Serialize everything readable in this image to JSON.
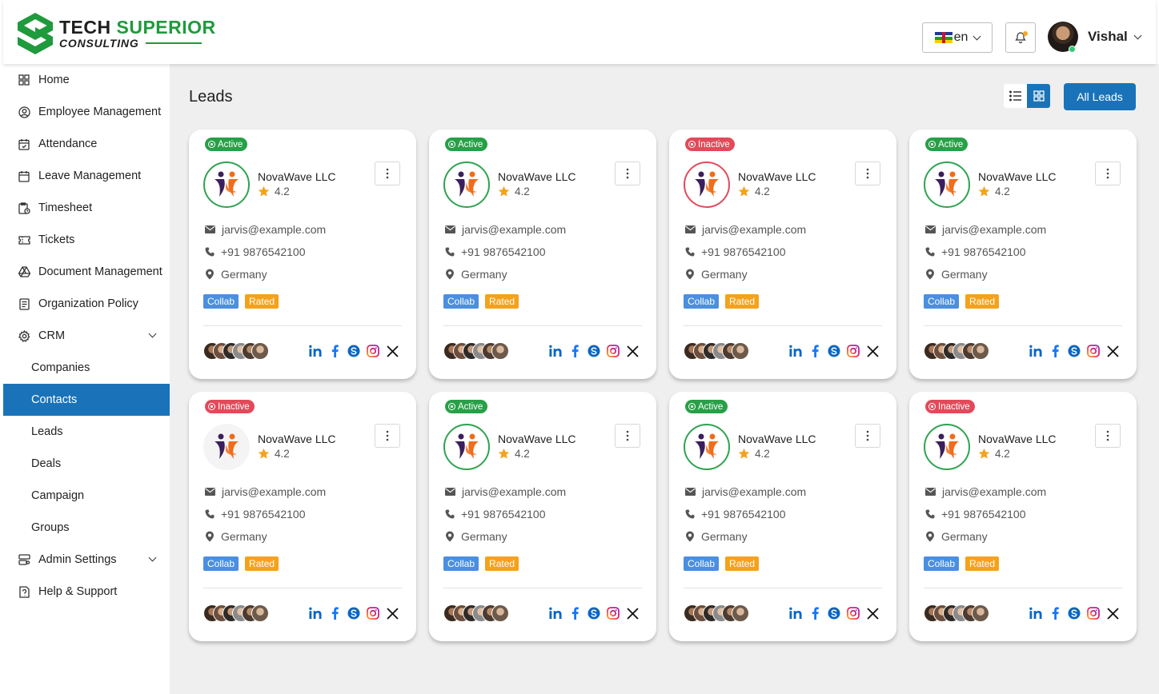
{
  "brand": {
    "line1_a": "TECH",
    "line1_b": "SUPERIOR",
    "line2": "CONSULTING"
  },
  "header": {
    "language": "en",
    "user_name": "Vishal"
  },
  "sidebar": {
    "items": [
      {
        "label": "Home",
        "icon": "grid-icon"
      },
      {
        "label": "Employee Management",
        "icon": "user-circle-icon"
      },
      {
        "label": "Attendance",
        "icon": "calendar-check-icon"
      },
      {
        "label": "Leave Management",
        "icon": "calendar-icon"
      },
      {
        "label": "Timesheet",
        "icon": "clipboard-clock-icon"
      },
      {
        "label": "Tickets",
        "icon": "ticket-icon"
      },
      {
        "label": "Document Management",
        "icon": "drive-icon"
      },
      {
        "label": "Organization Policy",
        "icon": "document-icon"
      },
      {
        "label": "CRM",
        "icon": "gear-icon"
      },
      {
        "label": "Companies"
      },
      {
        "label": "Contacts"
      },
      {
        "label": "Leads"
      },
      {
        "label": "Deals"
      },
      {
        "label": "Campaign"
      },
      {
        "label": "Groups"
      },
      {
        "label": "Admin Settings",
        "icon": "settings-panel-icon"
      },
      {
        "label": "Help & Support",
        "icon": "help-document-icon"
      }
    ],
    "active": "Contacts"
  },
  "main": {
    "title": "Leads",
    "all_leads_label": "All Leads"
  },
  "cards": [
    {
      "status": "Active",
      "name": "NovaWave LLC",
      "rating": "4.2",
      "email": "jarvis@example.com",
      "phone": "+91 9876542100",
      "location": "Germany",
      "tags": [
        "Collab",
        "Rated"
      ]
    },
    {
      "status": "Active",
      "name": "NovaWave LLC",
      "rating": "4.2",
      "email": "jarvis@example.com",
      "phone": "+91 9876542100",
      "location": "Germany",
      "tags": [
        "Collab",
        "Rated"
      ]
    },
    {
      "status": "Inactive",
      "name": "NovaWave LLC",
      "rating": "4.2",
      "email": "jarvis@example.com",
      "phone": "+91 9876542100",
      "location": "Germany",
      "tags": [
        "Collab",
        "Rated"
      ]
    },
    {
      "status": "Active",
      "name": "NovaWave LLC",
      "rating": "4.2",
      "email": "jarvis@example.com",
      "phone": "+91 9876542100",
      "location": "Germany",
      "tags": [
        "Collab",
        "Rated"
      ]
    },
    {
      "status": "Inactive",
      "name": "NovaWave LLC",
      "rating": "4.2",
      "email": "jarvis@example.com",
      "phone": "+91 9876542100",
      "location": "Germany",
      "tags": [
        "Collab",
        "Rated"
      ]
    },
    {
      "status": "Active",
      "name": "NovaWave LLC",
      "rating": "4.2",
      "email": "jarvis@example.com",
      "phone": "+91 9876542100",
      "location": "Germany",
      "tags": [
        "Collab",
        "Rated"
      ]
    },
    {
      "status": "Active",
      "name": "NovaWave LLC",
      "rating": "4.2",
      "email": "jarvis@example.com",
      "phone": "+91 9876542100",
      "location": "Germany",
      "tags": [
        "Collab",
        "Rated"
      ]
    },
    {
      "status": "Inactive",
      "name": "NovaWave LLC",
      "rating": "4.2",
      "email": "jarvis@example.com",
      "phone": "+91 9876542100",
      "location": "Germany",
      "tags": [
        "Collab",
        "Rated"
      ]
    }
  ],
  "colors": {
    "primary": "#1a73b8",
    "active": "#27a047",
    "inactive": "#e24a5a",
    "collab": "#4a8fe0",
    "rated": "#f5a21b",
    "brand_green": "#1f9a3c"
  }
}
